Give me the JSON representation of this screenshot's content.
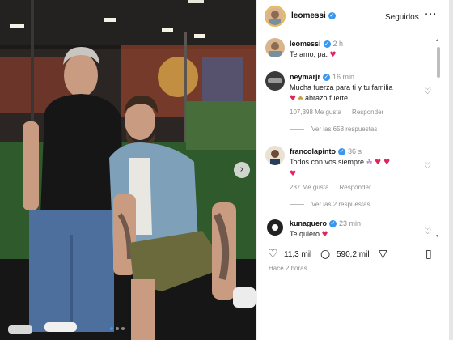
{
  "post": {
    "username": "leomessi",
    "follow_label": "Seguidos",
    "more_icon": "more-horizontal-icon"
  },
  "caption": {
    "username": "leomessi",
    "time": "2 h",
    "text": "Te amo, pa."
  },
  "comments": [
    {
      "username": "neymarjr",
      "time": "16 min",
      "text": "Mucha fuerza para ti y tu familia",
      "text2": "abrazo fuerte",
      "likes": "107,398 Me gusta",
      "reply_label": "Responder",
      "replies": "Ver las 658 respuestas"
    },
    {
      "username": "francolapinto",
      "time": "36 s",
      "text": "Todos con vos siempre",
      "likes": "237 Me gusta",
      "reply_label": "Responder",
      "replies": "Ver las 2 respuestas"
    },
    {
      "username": "kunaguero",
      "time": "23 min",
      "text": "Te quiero"
    }
  ],
  "actions": {
    "likes_count": "11,3 mil",
    "comments_count": "590,2 mil"
  },
  "timestamp": "Hace 2 horas",
  "colors": {
    "accent": "#3897f0",
    "heart": "#e0245e"
  }
}
